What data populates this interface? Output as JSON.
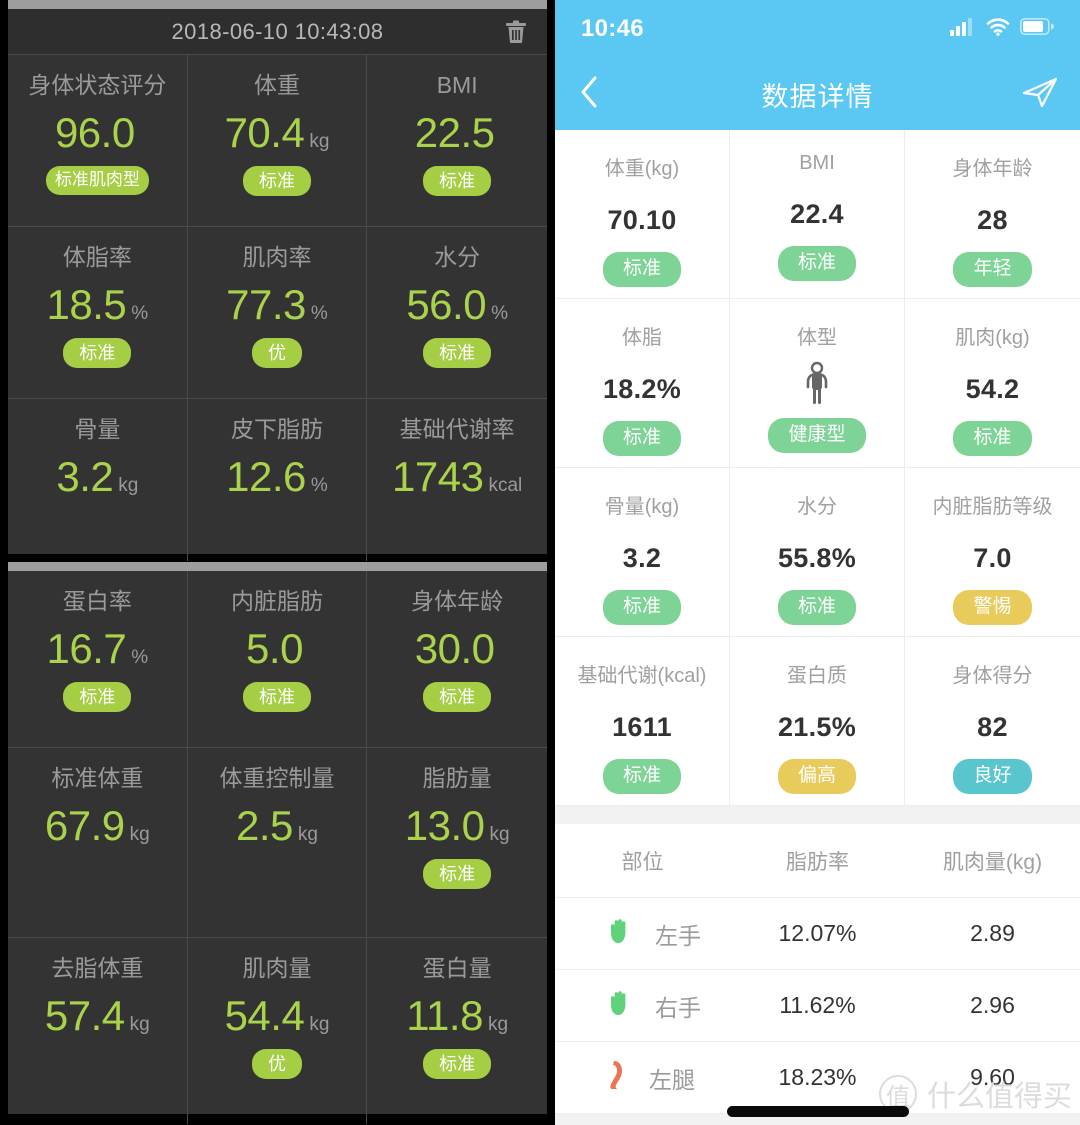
{
  "left_panel": {
    "capture_a": {
      "header": {
        "timestamp": "2018-06-10 10:43:08",
        "delete_icon": "trash-icon"
      },
      "rows": [
        [
          {
            "label": "身体状态评分",
            "value": "96.0",
            "unit": "",
            "badge": "标准肌肉型"
          },
          {
            "label": "体重",
            "value": "70.4",
            "unit": "kg",
            "badge": "标准"
          },
          {
            "label": "BMI",
            "value": "22.5",
            "unit": "",
            "badge": "标准"
          }
        ],
        [
          {
            "label": "体脂率",
            "value": "18.5",
            "unit": "%",
            "badge": "标准"
          },
          {
            "label": "肌肉率",
            "value": "77.3",
            "unit": "%",
            "badge": "优"
          },
          {
            "label": "水分",
            "value": "56.0",
            "unit": "%",
            "badge": "标准"
          }
        ],
        [
          {
            "label": "骨量",
            "value": "3.2",
            "unit": "kg",
            "badge": ""
          },
          {
            "label": "皮下脂肪",
            "value": "12.6",
            "unit": "%",
            "badge": ""
          },
          {
            "label": "基础代谢率",
            "value": "1743",
            "unit": "kcal",
            "badge": ""
          }
        ]
      ]
    },
    "capture_b": {
      "rows": [
        [
          {
            "label": "蛋白率",
            "value": "16.7",
            "unit": "%",
            "badge": "标准"
          },
          {
            "label": "内脏脂肪",
            "value": "5.0",
            "unit": "",
            "badge": "标准"
          },
          {
            "label": "身体年龄",
            "value": "30.0",
            "unit": "",
            "badge": "标准"
          }
        ],
        [
          {
            "label": "标准体重",
            "value": "67.9",
            "unit": "kg",
            "badge": ""
          },
          {
            "label": "体重控制量",
            "value": "2.5",
            "unit": "kg",
            "badge": ""
          },
          {
            "label": "脂肪量",
            "value": "13.0",
            "unit": "kg",
            "badge": "标准"
          }
        ],
        [
          {
            "label": "去脂体重",
            "value": "57.4",
            "unit": "kg",
            "badge": ""
          },
          {
            "label": "肌肉量",
            "value": "54.4",
            "unit": "kg",
            "badge": "优"
          },
          {
            "label": "蛋白量",
            "value": "11.8",
            "unit": "kg",
            "badge": "标准"
          }
        ]
      ]
    }
  },
  "right_panel": {
    "status_bar": {
      "time": "10:46",
      "signal_icon": "cellular-signal-icon",
      "wifi_icon": "wifi-icon",
      "battery_icon": "battery-icon"
    },
    "nav": {
      "back_icon": "chevron-left-icon",
      "title": "数据详情",
      "share_icon": "paper-plane-icon"
    },
    "metrics": [
      {
        "label": "体重(kg)",
        "value": "70.10",
        "badge": "标准",
        "badge_color": "#7ed396",
        "icon": ""
      },
      {
        "label": "BMI",
        "value": "22.4",
        "badge": "标准",
        "badge_color": "#7ed396",
        "icon": ""
      },
      {
        "label": "身体年龄",
        "value": "28",
        "badge": "年轻",
        "badge_color": "#7ed396",
        "icon": ""
      },
      {
        "label": "体脂",
        "value": "18.2%",
        "badge": "标准",
        "badge_color": "#7ed396",
        "icon": ""
      },
      {
        "label": "体型",
        "value": "",
        "badge": "健康型",
        "badge_color": "#7ed396",
        "icon": "body-figure-icon"
      },
      {
        "label": "肌肉(kg)",
        "value": "54.2",
        "badge": "标准",
        "badge_color": "#7ed396",
        "icon": ""
      },
      {
        "label": "骨量(kg)",
        "value": "3.2",
        "badge": "标准",
        "badge_color": "#7ed396",
        "icon": ""
      },
      {
        "label": "水分",
        "value": "55.8%",
        "badge": "标准",
        "badge_color": "#7ed396",
        "icon": ""
      },
      {
        "label": "内脏脂肪等级",
        "value": "7.0",
        "badge": "警惕",
        "badge_color": "#e9cb5c",
        "icon": ""
      },
      {
        "label": "基础代谢(kcal)",
        "value": "1611",
        "badge": "标准",
        "badge_color": "#7ed396",
        "icon": ""
      },
      {
        "label": "蛋白质",
        "value": "21.5%",
        "badge": "偏高",
        "badge_color": "#e9cb5c",
        "icon": ""
      },
      {
        "label": "身体得分",
        "value": "82",
        "badge": "良好",
        "badge_color": "#59c5cd",
        "icon": ""
      }
    ],
    "table": {
      "headers": [
        "部位",
        "脂肪率",
        "肌肉量(kg)"
      ],
      "rows": [
        {
          "icon": "hand-icon",
          "icon_color": "#5fd27a",
          "part": "左手",
          "fat_rate": "12.07%",
          "muscle": "2.89"
        },
        {
          "icon": "hand-icon",
          "icon_color": "#5fd27a",
          "part": "右手",
          "fat_rate": "11.62%",
          "muscle": "2.96"
        },
        {
          "icon": "leg-icon",
          "icon_color": "#ec7455",
          "part": "左腿",
          "fat_rate": "18.23%",
          "muscle": "9.60"
        }
      ]
    },
    "watermark": {
      "mark": "值",
      "text": "什么值得买"
    }
  },
  "colors": {
    "dark_bg": "#333333",
    "dark_header": "#2e2e2e",
    "accent_green_dark_ui": "#aad24b",
    "badge_green_dark_ui": "#a5ce45",
    "ios_blue": "#5ac8f2",
    "badge_green": "#7ed396",
    "badge_yellow": "#e9cb5c",
    "badge_teal": "#59c5cd"
  }
}
